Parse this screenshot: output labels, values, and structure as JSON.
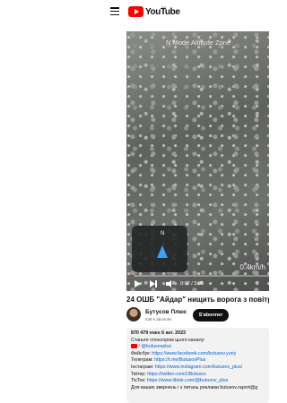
{
  "header": {
    "logo_text": "YouTube",
    "logo_region": "FR"
  },
  "player": {
    "overlay_top": "N Mode    Altitude Zone",
    "overlay_speed": "0.4km/h",
    "time": "0:02 / 3:05",
    "progress": 0.01,
    "minimap_label": "N"
  },
  "video": {
    "title": "24 ОШБ \"Айдар\" нищить ворога з повітря на",
    "channel": "Бутусов Плюс",
    "subscribers": "639 k abonnés",
    "subscribe_label": "S'abonner"
  },
  "description": {
    "stats": "870 479 vues  6 avr. 2023",
    "line1": "Станьте спонсором цього каналу:",
    "line2_handle": "/ @butusovplus",
    "facebook_label": "Фейсбук:",
    "facebook_url": "https://www.facebook.com/butusov.yuriy",
    "telegram_label": "Телеграм:",
    "telegram_url": "https://t.me/ButusovPlus",
    "instagram_label": "Інстаграм:",
    "instagram_url": "https://www.instagram.com/butusov_plus/",
    "twitter_label": "Твітер:",
    "twitter_url": "https://twitter.com/UButusov",
    "tiktok_label": "ТікТок:",
    "tiktok_url": "https://www.tiktok.com/@butusov_plus",
    "contact": "Для ваших звернень і з питань реклами butusov.raport@g"
  }
}
